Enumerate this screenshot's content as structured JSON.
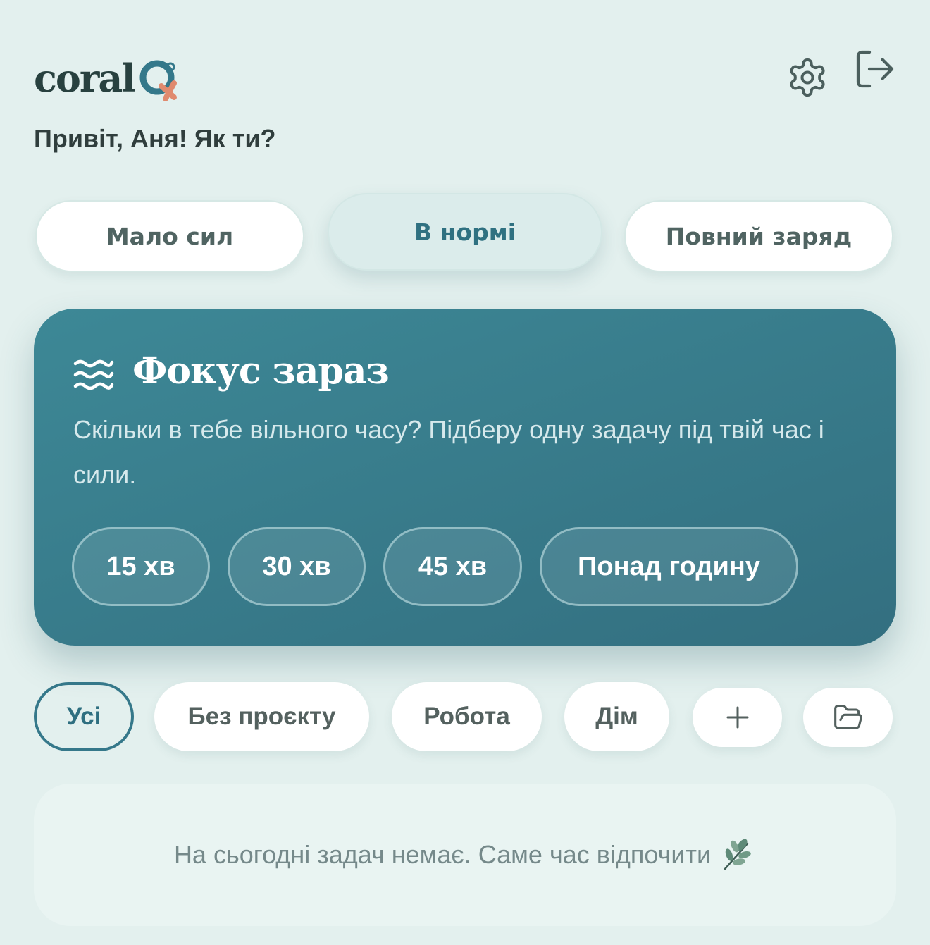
{
  "brand": {
    "name": "coral"
  },
  "icons": {
    "settings": "gear-icon",
    "logout": "logout-icon",
    "focus": "waves-icon",
    "add": "plus-icon",
    "folder": "folder-icon",
    "empty": "leaf-icon"
  },
  "greeting": "Привіт, Аня! Як ти?",
  "mood": {
    "options": [
      "Мало сил",
      "В нормі",
      "Повний заряд"
    ],
    "selected": "В нормі"
  },
  "focus": {
    "title": "Фокус зараз",
    "subtitle": "Скільки в тебе вільного часу? Підберу одну задачу під твій час і сили.",
    "times": [
      "15 хв",
      "30 хв",
      "45 хв",
      "Понад годину"
    ]
  },
  "filters": {
    "items": [
      "Усі",
      "Без проєкту",
      "Робота",
      "Дім"
    ],
    "active": "Усі",
    "add_label": "+"
  },
  "empty_state": {
    "message": "На сьогодні задач немає. Саме час відпочити"
  },
  "colors": {
    "background": "#e3f0ee",
    "accent": "#35788a",
    "card": "#3a7f8f",
    "logo_coral": "#e08a6e"
  }
}
